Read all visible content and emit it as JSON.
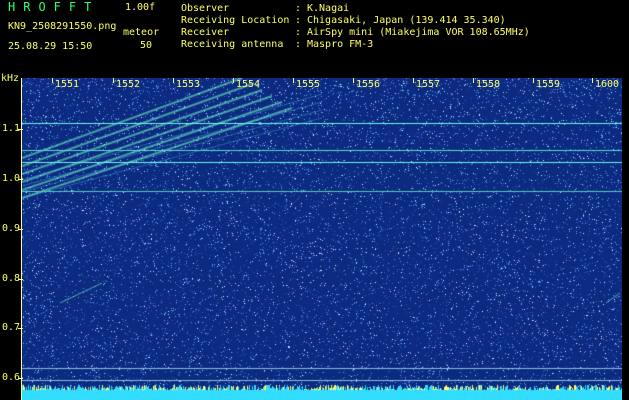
{
  "header": {
    "app_title": "HROFFT",
    "app_version": "1.00f",
    "file_name": "KN9_2508291550.png",
    "timestamp": "25.08.29 15:50",
    "meteor_label": "meteor",
    "meteor_count": "50",
    "info": [
      {
        "label": "Observer",
        "value": "K.Nagai"
      },
      {
        "label": "Receiving Location",
        "value": "Chigasaki, Japan (139.414 35.340)"
      },
      {
        "label": "Receiver",
        "value": "AirSpy mini (Miakejima VOR 108.65MHz)"
      },
      {
        "label": "Receiving antenna",
        "value": "Maspro FM-3"
      }
    ],
    "separator": ":"
  },
  "spectrogram": {
    "unit": "kHz",
    "y_ticks": [
      "1.1",
      "1.0",
      "0.9",
      "0.8",
      "0.7",
      "0.6"
    ],
    "x_ticks": [
      "1551",
      "1552",
      "1553",
      "1554",
      "1555",
      "1556",
      "1557",
      "1558",
      "1559",
      "1600"
    ],
    "colors": {
      "background": "#0c2a80",
      "noise": "#3a7ad8",
      "signal": "#66ffcc",
      "text": "#ffff66"
    }
  }
}
